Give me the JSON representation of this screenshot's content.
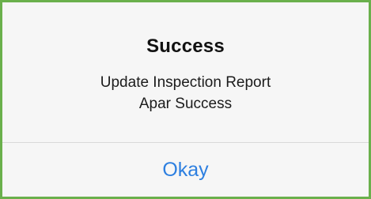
{
  "dialog": {
    "title": "Success",
    "message_lines": [
      "Update Inspection Report",
      "Apar Success"
    ],
    "button_label": "Okay"
  },
  "colors": {
    "frame": "#6ab04c",
    "dialog_bg": "#f6f6f6",
    "button_text": "#2d7fe0",
    "divider": "#d9d9d9"
  }
}
